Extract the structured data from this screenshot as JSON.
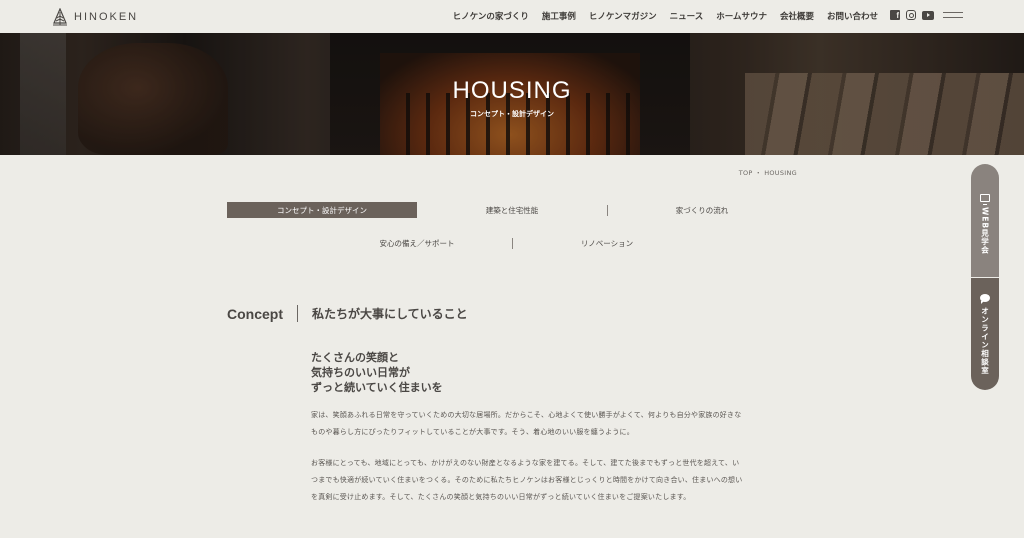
{
  "brand": {
    "name": "HINOKEN"
  },
  "nav": {
    "items": [
      "ヒノケンの家づくり",
      "施工事例",
      "ヒノケンマガジン",
      "ニュース",
      "ホームサウナ",
      "会社概要",
      "お問い合わせ"
    ]
  },
  "social": [
    "facebook-icon",
    "instagram-icon",
    "youtube-icon"
  ],
  "hero": {
    "title": "HOUSING",
    "subtitle": "コンセプト・設計デザイン"
  },
  "breadcrumb": "TOP ・ HOUSING",
  "tabs": {
    "row1": [
      "コンセプト・設計デザイン",
      "建築と住宅性能",
      "家づくりの流れ"
    ],
    "row2": [
      "安心の備え／サポート",
      "リノベーション"
    ],
    "active": "コンセプト・設計デザイン"
  },
  "concept": {
    "en": "Concept",
    "ja": "私たちが大事にしていること",
    "lead": [
      "たくさんの笑顔と",
      "気持ちのいい日常が",
      "ずっと続いていく住まいを"
    ],
    "paragraphs": [
      [
        "家は、笑顔あふれる日常を守っていくための大切な居場所。だからこそ、心地よくて使い勝手がよくて、何よりも自分や家族の好きな",
        "ものや暮らし方にぴったりフィットしていることが大事です。そう、着心地のいい服を纏うように。"
      ],
      [
        "お客様にとっても、地域にとっても、かけがえのない財産となるような家を建てる。そして、建てた後までもずっと世代を超えて、い",
        "つまでも快適が続いていく住まいをつくる。そのために私たちヒノケンはお客様とじっくりと時間をかけて向き合い、住まいへの想い",
        "を真剣に受け止めます。そして、たくさんの笑顔と気持ちのいい日常がずっと続いていく住まいをご提案いたします。"
      ]
    ]
  },
  "side": {
    "web_label": "WEB見学会",
    "online_label": "オンライン相談室"
  },
  "colors": {
    "background": "#edece7",
    "active_tab": "#6b625b",
    "side_web": "#8a837e"
  }
}
